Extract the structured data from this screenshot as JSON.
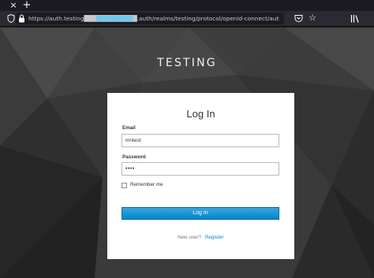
{
  "browser": {
    "tab_close": "×",
    "tab_new": "+",
    "url": "https://auth.testing████████████.auth/realms/testing/protocol/openid-connect/auth?response_type=code",
    "bookmark_star": "☆"
  },
  "page": {
    "realm_title": "TESTING",
    "form": {
      "title": "Log In",
      "email_label": "Email",
      "email_value": "mntest",
      "password_label": "Password",
      "password_value": "••••",
      "remember_label": "Remember me",
      "login_button": "Log In",
      "new_user_text": "New user?",
      "register_link": "Register"
    }
  },
  "colors": {
    "button_primary": "#0088ce",
    "link": "#0088ce",
    "background": "#3a3a3a"
  }
}
